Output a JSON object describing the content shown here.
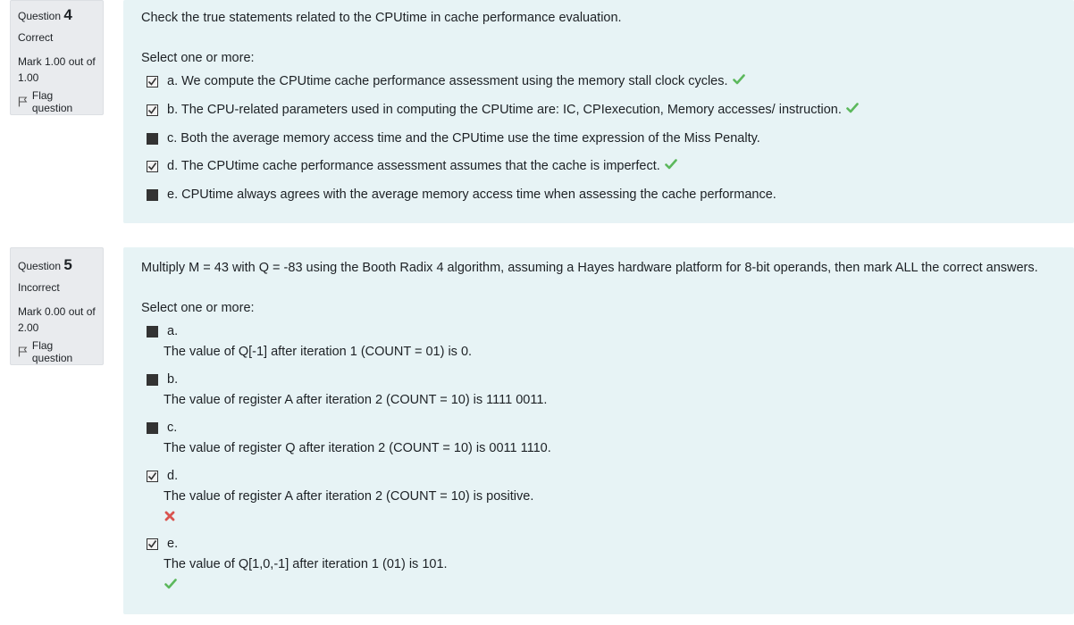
{
  "q4": {
    "info": {
      "label": "Question",
      "number": "4",
      "state": "Correct",
      "grade": "Mark 1.00 out of 1.00",
      "flag": "Flag question"
    },
    "text": "Check the true statements related to the CPUtime in cache performance evaluation.",
    "prompt": "Select one or more:",
    "options": [
      {
        "text": "a. We compute the CPUtime cache performance assessment using the memory stall clock cycles.",
        "checked": true,
        "feedback": "correct"
      },
      {
        "text": "b. The CPU-related parameters used in computing the CPUtime are: IC, CPIexecution, Memory accesses/ instruction.",
        "checked": true,
        "feedback": "correct"
      },
      {
        "text": "c. Both the average memory access time and the CPUtime use the time expression of the Miss Penalty.",
        "checked": false,
        "feedback": ""
      },
      {
        "text": "d. The CPUtime cache performance assessment assumes that the cache is imperfect.",
        "checked": true,
        "feedback": "correct"
      },
      {
        "text": "e. CPUtime always agrees with the average memory access time when assessing the cache performance.",
        "checked": false,
        "feedback": ""
      }
    ]
  },
  "q5": {
    "info": {
      "label": "Question",
      "number": "5",
      "state": "Incorrect",
      "grade": "Mark 0.00 out of 2.00",
      "flag": "Flag question"
    },
    "text": "Multiply M = 43 with Q = -83 using the Booth Radix 4 algorithm, assuming a Hayes hardware platform for 8-bit operands, then mark ALL the correct answers.",
    "prompt": "Select one or more:",
    "options": [
      {
        "letter": "a.",
        "text": "The value of Q[-1] after iteration 1 (COUNT = 01) is 0.",
        "checked": false,
        "feedback": ""
      },
      {
        "letter": "b.",
        "text": "The value of register A after iteration 2 (COUNT = 10) is 1111 0011.",
        "checked": false,
        "feedback": ""
      },
      {
        "letter": "c.",
        "text": "The value of register Q after iteration 2 (COUNT = 10) is 0011 1110.",
        "checked": false,
        "feedback": ""
      },
      {
        "letter": "d.",
        "text": "The value of register A after iteration 2 (COUNT = 10) is positive.",
        "checked": true,
        "feedback": "incorrect"
      },
      {
        "letter": "e.",
        "text": "The value of Q[1,0,-1] after iteration 1 (01) is 101.",
        "checked": true,
        "feedback": "correct"
      }
    ]
  },
  "colors": {
    "correct": "#5cb85c",
    "incorrect": "#d9534f",
    "content_bg": "#e7f3f5",
    "info_bg": "#e9ebee"
  }
}
